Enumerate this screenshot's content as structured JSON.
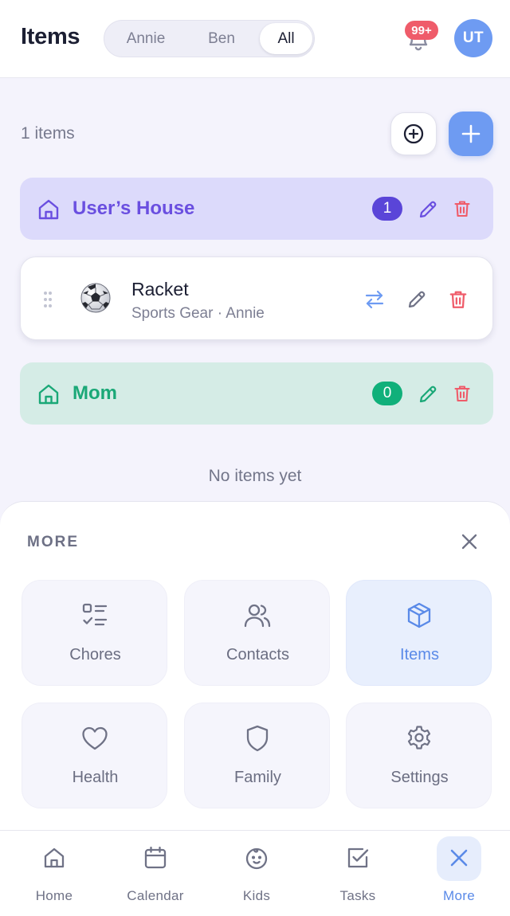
{
  "header": {
    "title": "Items",
    "filters": [
      {
        "label": "Annie",
        "active": false
      },
      {
        "label": "Ben",
        "active": false
      },
      {
        "label": "All",
        "active": true
      }
    ],
    "notification_badge": "99+",
    "avatar_initials": "UT"
  },
  "toolbar": {
    "items_count": "1 items",
    "circle_add_icon": "plus-circle-icon",
    "add_icon": "plus-icon"
  },
  "groups": [
    {
      "name": "User’s House",
      "count": "1",
      "color": "#6a4fe0",
      "background": "#dcdafb",
      "icon": "home-icon"
    },
    {
      "name": "Mom",
      "count": "0",
      "color": "#1aa877",
      "background": "#d5ece6",
      "icon": "home-icon"
    }
  ],
  "item": {
    "name": "Racket",
    "meta": "Sports Gear · Annie",
    "icon": "soccer-ball-icon"
  },
  "empty_state": "No items yet",
  "more_sheet": {
    "title": "MORE",
    "tiles": [
      {
        "label": "Chores",
        "icon": "checklist-icon",
        "active": false
      },
      {
        "label": "Contacts",
        "icon": "users-icon",
        "active": false
      },
      {
        "label": "Items",
        "icon": "box-icon",
        "active": true
      },
      {
        "label": "Health",
        "icon": "heart-icon",
        "active": false
      },
      {
        "label": "Family",
        "icon": "shield-icon",
        "active": false
      },
      {
        "label": "Settings",
        "icon": "gear-icon",
        "active": false
      }
    ]
  },
  "bottom_nav": [
    {
      "label": "Home",
      "icon": "home-icon",
      "active": false
    },
    {
      "label": "Calendar",
      "icon": "calendar-icon",
      "active": false
    },
    {
      "label": "Kids",
      "icon": "baby-face-icon",
      "active": false
    },
    {
      "label": "Tasks",
      "icon": "checkbox-icon",
      "active": false
    },
    {
      "label": "More",
      "icon": "close-icon",
      "active": true
    }
  ],
  "colors": {
    "accent": "#6e9bf2",
    "danger": "#ef5c6a",
    "page_background": "#f4f3fc"
  }
}
